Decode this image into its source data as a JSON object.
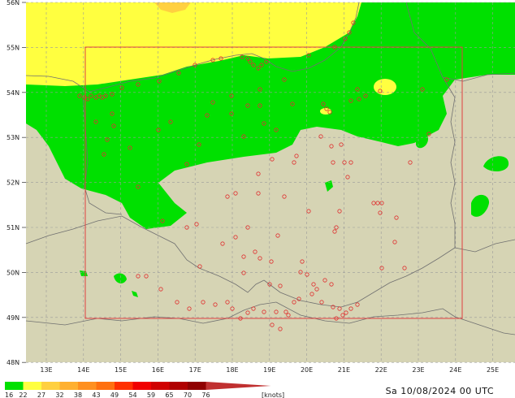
{
  "map": {
    "timestamp": "Sa 10/08/2024 00 UTC",
    "colors": {
      "land": "#d6d4b4",
      "wind_16_22": "#00e000",
      "wind_22_27": "#ffff40",
      "wind_27_32": "#ffd040",
      "wind_32_38": "#ffb030",
      "bbox": "#e04040",
      "station": "#e03030",
      "grid": "#9a9a9a",
      "border": "#707070"
    },
    "lat_labels": [
      "56N",
      "55N",
      "54N",
      "53N",
      "52N",
      "51N",
      "50N",
      "49N",
      "48N"
    ],
    "lon_labels": [
      "13E",
      "14E",
      "15E",
      "16E",
      "17E",
      "18E",
      "19E",
      "20E",
      "21E",
      "22E",
      "23E",
      "24E",
      "25E"
    ],
    "legend": {
      "values": [
        "16",
        "22",
        "27",
        "32",
        "38",
        "43",
        "49",
        "54",
        "59",
        "65",
        "70",
        "76"
      ],
      "unit": "[knots]",
      "colors": [
        "#00e000",
        "#ffff40",
        "#ffd040",
        "#ffb030",
        "#ff9020",
        "#ff7010",
        "#ff3000",
        "#f00000",
        "#d00000",
        "#b00000",
        "#900000",
        "#c03030"
      ]
    }
  }
}
